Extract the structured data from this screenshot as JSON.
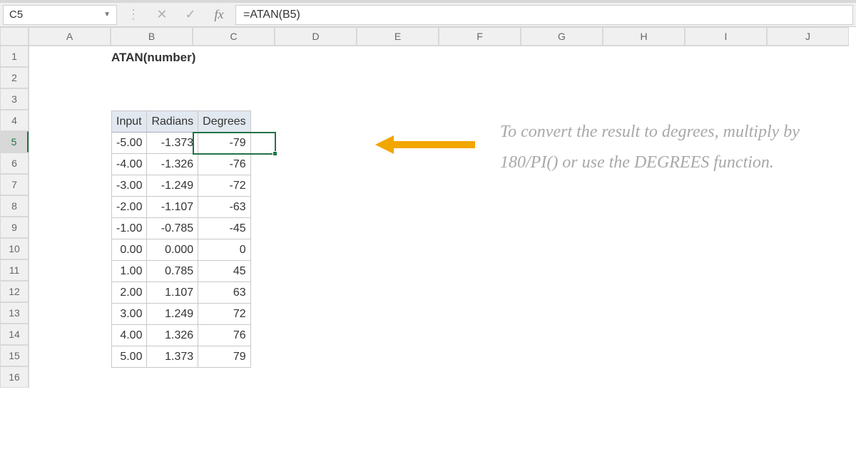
{
  "formula_bar": {
    "cell_ref": "C5",
    "formula": "=ATAN(B5)"
  },
  "columns": [
    "A",
    "B",
    "C",
    "D",
    "E",
    "F",
    "G",
    "H",
    "I",
    "J"
  ],
  "rows": [
    "1",
    "2",
    "3",
    "4",
    "5",
    "6",
    "7",
    "8",
    "9",
    "10",
    "11",
    "12",
    "13",
    "14",
    "15",
    "16"
  ],
  "table_title": "ATAN(number)",
  "table_headers": {
    "c0": "Input",
    "c1": "Radians",
    "c2": "Degrees"
  },
  "selected_cell": "C5",
  "annotation": "To convert the result to degrees, multiply by 180/PI() or use the DEGREES function.",
  "chart_data": {
    "type": "table",
    "columns": [
      "Input",
      "Radians",
      "Degrees"
    ],
    "rows": [
      {
        "input": "-5.00",
        "radians": "-1.373",
        "degrees": "-79"
      },
      {
        "input": "-4.00",
        "radians": "-1.326",
        "degrees": "-76"
      },
      {
        "input": "-3.00",
        "radians": "-1.249",
        "degrees": "-72"
      },
      {
        "input": "-2.00",
        "radians": "-1.107",
        "degrees": "-63"
      },
      {
        "input": "-1.00",
        "radians": "-0.785",
        "degrees": "-45"
      },
      {
        "input": "0.00",
        "radians": "0.000",
        "degrees": "0"
      },
      {
        "input": "1.00",
        "radians": "0.785",
        "degrees": "45"
      },
      {
        "input": "2.00",
        "radians": "1.107",
        "degrees": "63"
      },
      {
        "input": "3.00",
        "radians": "1.249",
        "degrees": "72"
      },
      {
        "input": "4.00",
        "radians": "1.326",
        "degrees": "76"
      },
      {
        "input": "5.00",
        "radians": "1.373",
        "degrees": "79"
      }
    ]
  }
}
